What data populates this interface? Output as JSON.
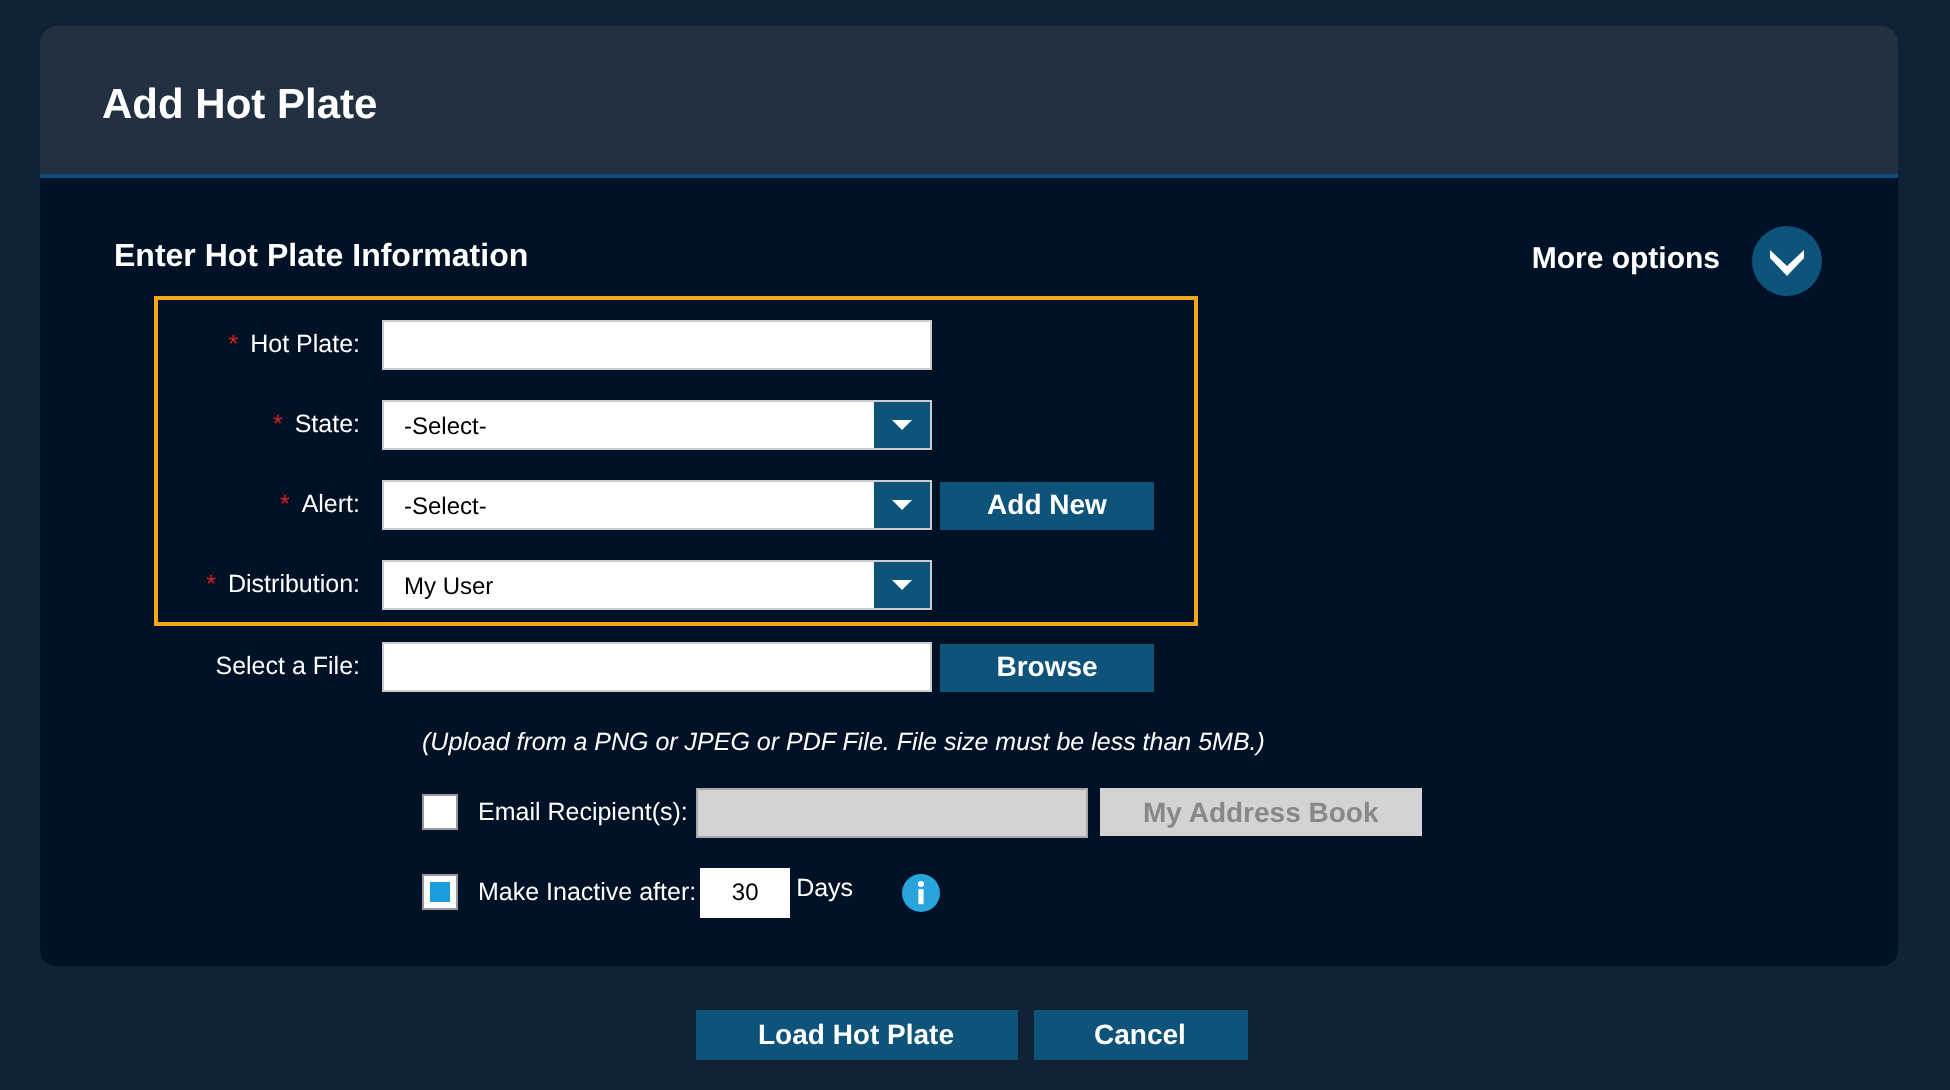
{
  "dialog": {
    "title": "Add Hot Plate"
  },
  "section_title": "Enter Hot Plate Information",
  "more_options": {
    "label": "More options",
    "expanded": false
  },
  "highlighted_fields": [
    {
      "kind": "text",
      "required_mark": "*",
      "label": "Hot Plate:"
    },
    {
      "kind": "select",
      "required_mark": "*",
      "label": "State:",
      "value": "-Select-"
    },
    {
      "kind": "select",
      "required_mark": "*",
      "label": "Alert:",
      "value": "-Select-",
      "button": "Add New"
    },
    {
      "kind": "select",
      "required_mark": "*",
      "label": "Distribution:",
      "value": "My User"
    }
  ],
  "other_fields": [
    {
      "kind": "text",
      "label": "Select a File:",
      "button": "Browse"
    }
  ],
  "note": "(Upload from a PNG or JPEG or PDF File. File size must be less than 5MB.)",
  "email": {
    "label": "Email Recipient(s):",
    "checked": false,
    "disabled": true,
    "button": "My Address Book"
  },
  "inactive": {
    "label": "Make Inactive after:",
    "checked": true,
    "value": "30",
    "unit": "Days"
  },
  "footer_buttons": [
    "Load Hot Plate",
    "Cancel"
  ]
}
